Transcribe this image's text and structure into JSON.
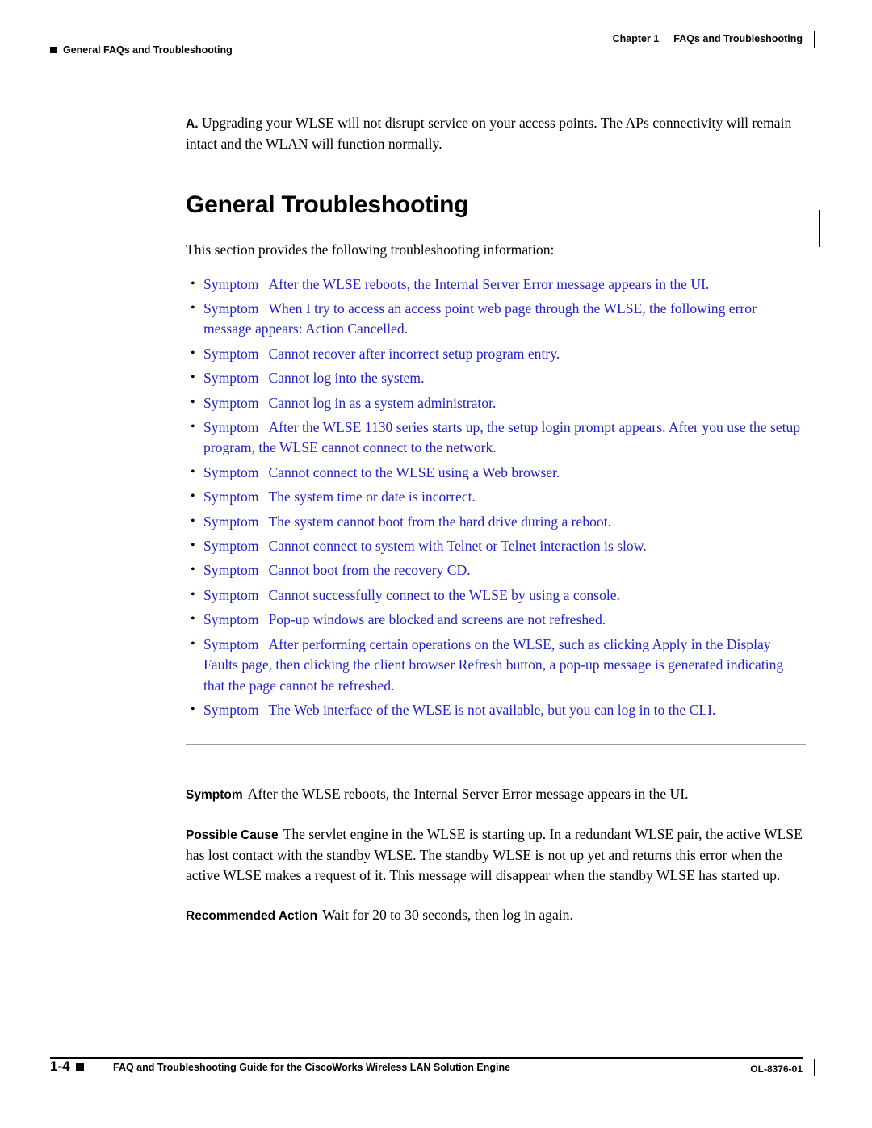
{
  "header": {
    "left_text": "General FAQs and Troubleshooting",
    "right_chapter": "Chapter 1",
    "right_title": "FAQs and Troubleshooting"
  },
  "answer": {
    "label": "A.",
    "text": "Upgrading your WLSE will not disrupt service on your access points. The APs connectivity will remain intact and the WLAN will function normally."
  },
  "section": {
    "title": "General Troubleshooting",
    "intro": "This section provides the following troubleshooting information:"
  },
  "symptom_links": [
    {
      "word": "Symptom",
      "text": "After the WLSE reboots, the Internal Server Error message appears in the UI."
    },
    {
      "word": "Symptom",
      "text": "When I try to access an access point web page through the WLSE, the following error message appears: Action Cancelled."
    },
    {
      "word": "Symptom",
      "text": "Cannot recover after incorrect setup program entry."
    },
    {
      "word": "Symptom",
      "text": "Cannot log into the system."
    },
    {
      "word": "Symptom",
      "text": "Cannot log in as a system administrator."
    },
    {
      "word": "Symptom",
      "text": "After the WLSE 1130 series starts up, the setup login prompt appears. After you use the setup program, the WLSE cannot connect to the network."
    },
    {
      "word": "Symptom",
      "text": "Cannot connect to the WLSE using a Web browser."
    },
    {
      "word": "Symptom",
      "text": "The system time or date is incorrect."
    },
    {
      "word": "Symptom",
      "text": "The system cannot boot from the hard drive during a reboot."
    },
    {
      "word": "Symptom",
      "text": "Cannot connect to system with Telnet or Telnet interaction is slow."
    },
    {
      "word": "Symptom",
      "text": "Cannot boot from the recovery CD."
    },
    {
      "word": "Symptom",
      "text": "Cannot successfully connect to the WLSE by using a console."
    },
    {
      "word": "Symptom",
      "text": "Pop-up windows are blocked and screens are not refreshed."
    },
    {
      "word": "Symptom",
      "text": "After performing certain operations on the WLSE, such as clicking Apply in the Display Faults page, then clicking the client browser Refresh button, a pop-up message is generated indicating that the page cannot be refreshed."
    },
    {
      "word": "Symptom",
      "text": "The Web interface of the WLSE is not available, but you can log in to the CLI."
    }
  ],
  "detail": {
    "symptom_label": "Symptom",
    "symptom_text": "After the WLSE reboots, the Internal Server Error message appears in the UI.",
    "cause_label": "Possible Cause",
    "cause_text": "The servlet engine in the WLSE is starting up. In a redundant WLSE pair, the active WLSE has lost contact with the standby WLSE. The standby WLSE is not up yet and returns this error when the active WLSE makes a request of it. This message will disappear when the standby WLSE has started up.",
    "action_label": "Recommended Action",
    "action_text": "Wait for 20 to 30 seconds, then log in again."
  },
  "footer": {
    "page_number": "1-4",
    "title": "FAQ and Troubleshooting Guide for the CiscoWorks Wireless LAN Solution Engine",
    "doc_id": "OL-8376-01"
  }
}
